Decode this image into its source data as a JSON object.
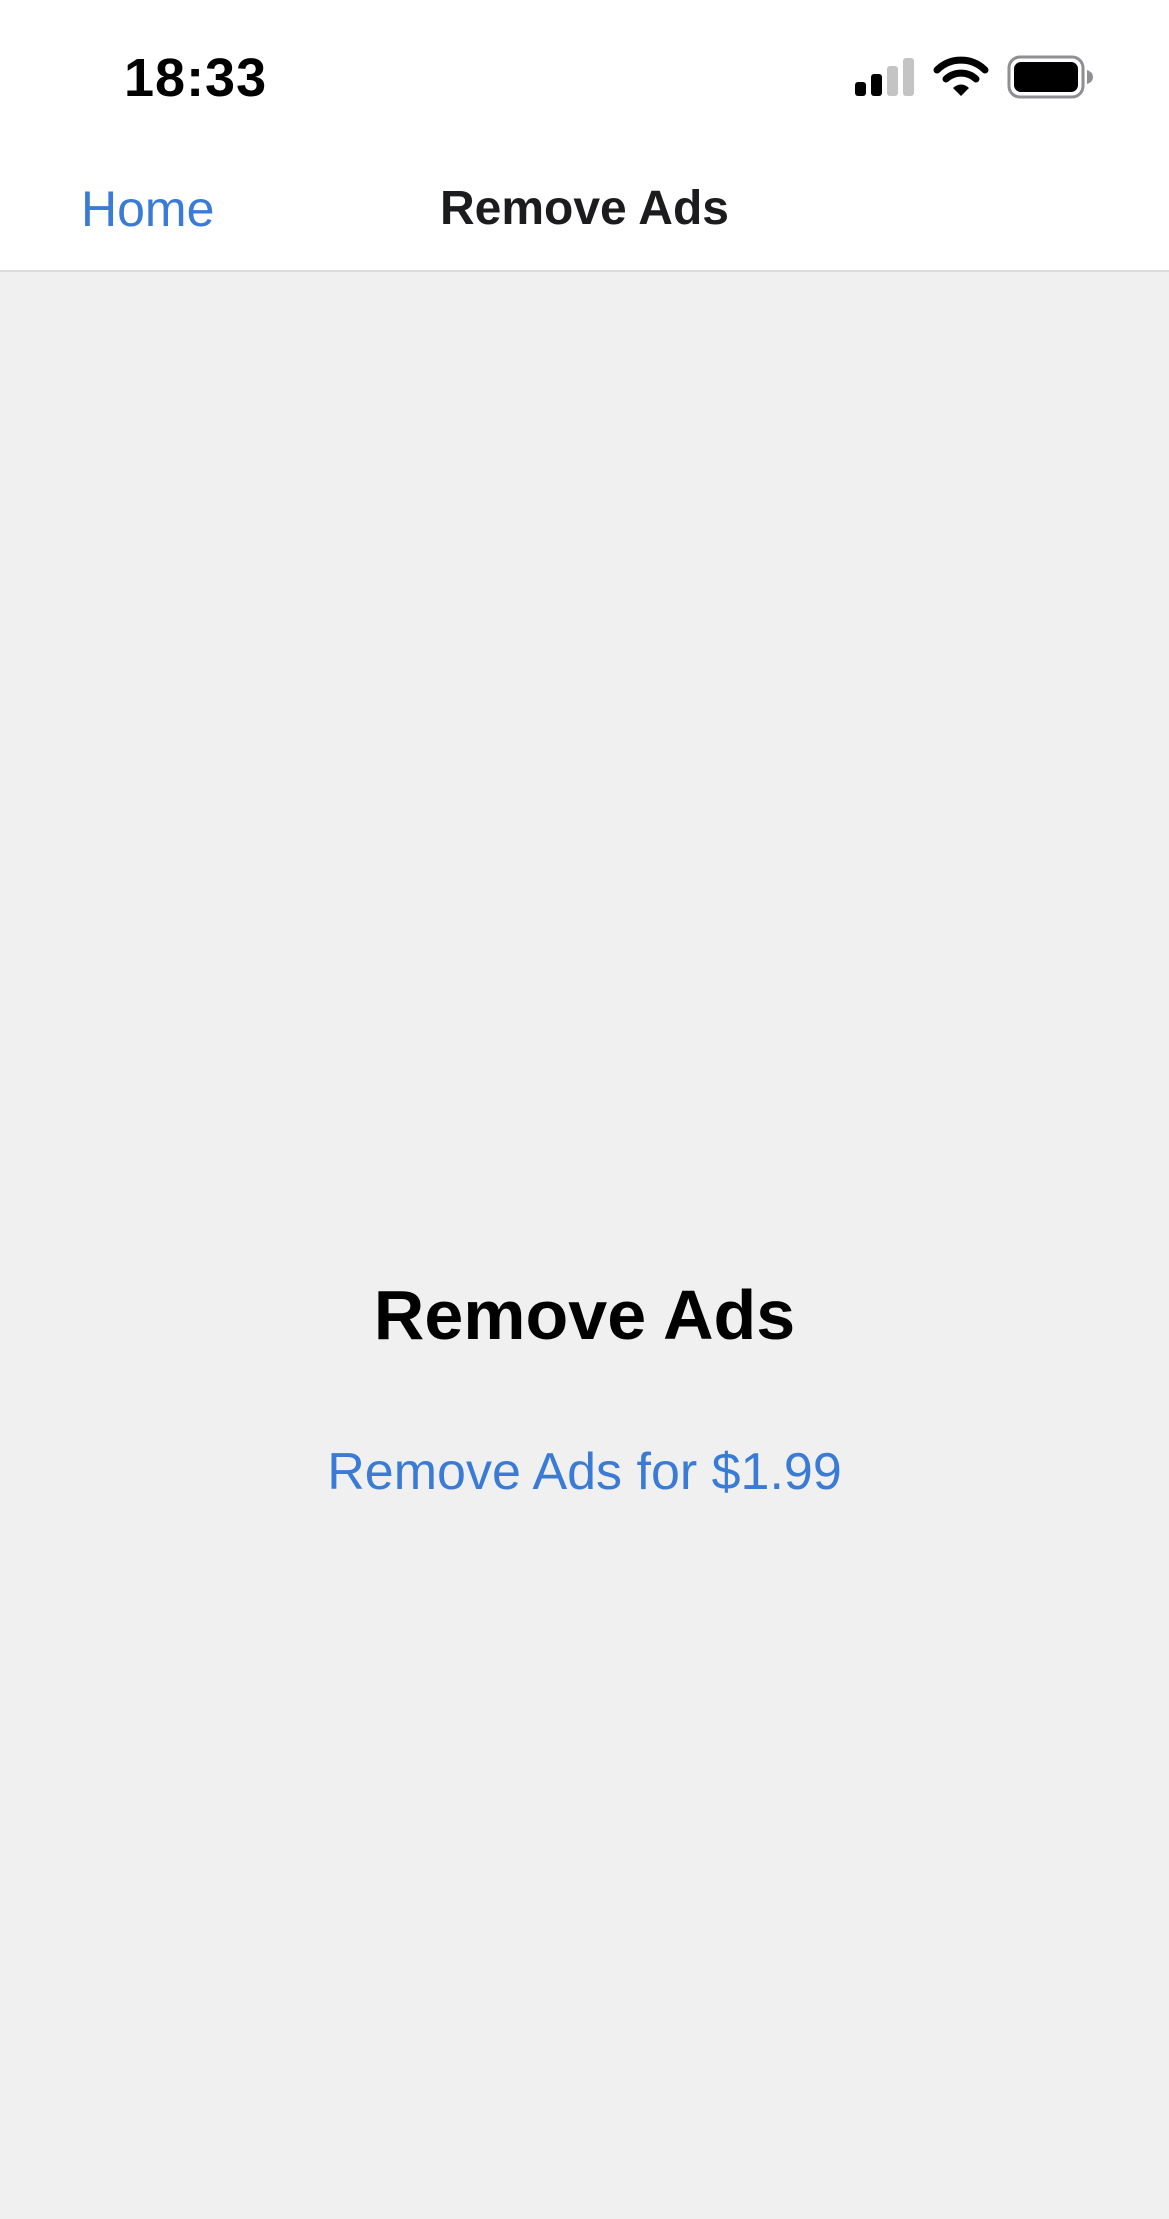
{
  "status_bar": {
    "time": "18:33",
    "icons": [
      "cellular-signal-icon",
      "wifi-icon",
      "battery-icon"
    ]
  },
  "nav_bar": {
    "back_label": "Home",
    "title": "Remove Ads"
  },
  "main": {
    "heading": "Remove Ads",
    "purchase_label": "Remove Ads for $1.99"
  },
  "colors": {
    "accent": "#3a7bd5",
    "background": "#f0f0f0",
    "bar_background": "#ffffff"
  }
}
